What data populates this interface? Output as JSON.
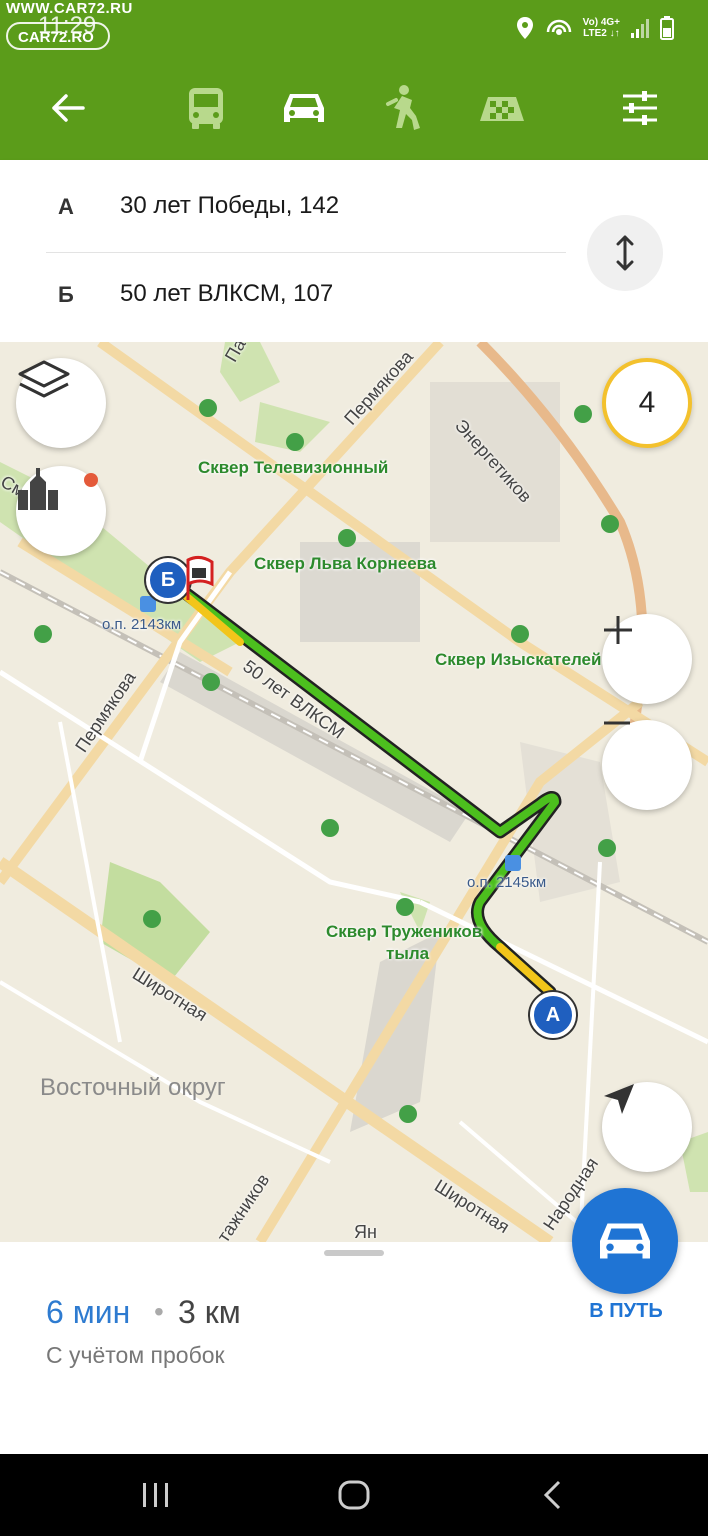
{
  "status_bar": {
    "watermark_site": "WWW.CAR72.RU",
    "watermark_logo": "CAR72.RO",
    "time": "11:29",
    "network_top": "Vo) 4G+",
    "network_bottom": "LTE2 ↓↑",
    "icons": [
      "location-icon",
      "hotspot-icon",
      "signal-icon",
      "battery-icon"
    ]
  },
  "toolbar": {
    "buttons": [
      "back-arrow-icon",
      "bus-icon",
      "car-icon",
      "pedestrian-icon",
      "taxi-icon",
      "settings-sliders-icon"
    ],
    "active": "car"
  },
  "route": {
    "from_letter": "А",
    "from_address": "30 лет Победы, 142",
    "to_letter": "Б",
    "to_address": "50 лет ВЛКСМ, 107"
  },
  "map": {
    "traffic_level": "4",
    "marker_a": "А",
    "marker_b": "Б",
    "parks": [
      "Сквер Телевизионный",
      "Сквер Льва Корнеева",
      "Сквер Изыскателей",
      "Сквер Тружеников",
      "тыла"
    ],
    "streets": [
      "Пермякова",
      "Энергетиков",
      "50 лет ВЛКСМ",
      "Пермякова",
      "Широтная",
      "Широтная",
      "Народная",
      "тажников",
      "Ян",
      "Па",
      "См"
    ],
    "stops": [
      "о.п. 2143км",
      "о.п. 2145км"
    ],
    "district": "Восточный округ"
  },
  "summary": {
    "time": "6 мин",
    "separator": "•",
    "distance": "3 км",
    "note": "С учётом пробок",
    "go_label": "В ПУТЬ"
  },
  "colors": {
    "brand_green": "#5b9c1a",
    "route_green": "#4cbf1e",
    "route_yellow": "#f2c51a",
    "accent_blue": "#1f74d4"
  }
}
